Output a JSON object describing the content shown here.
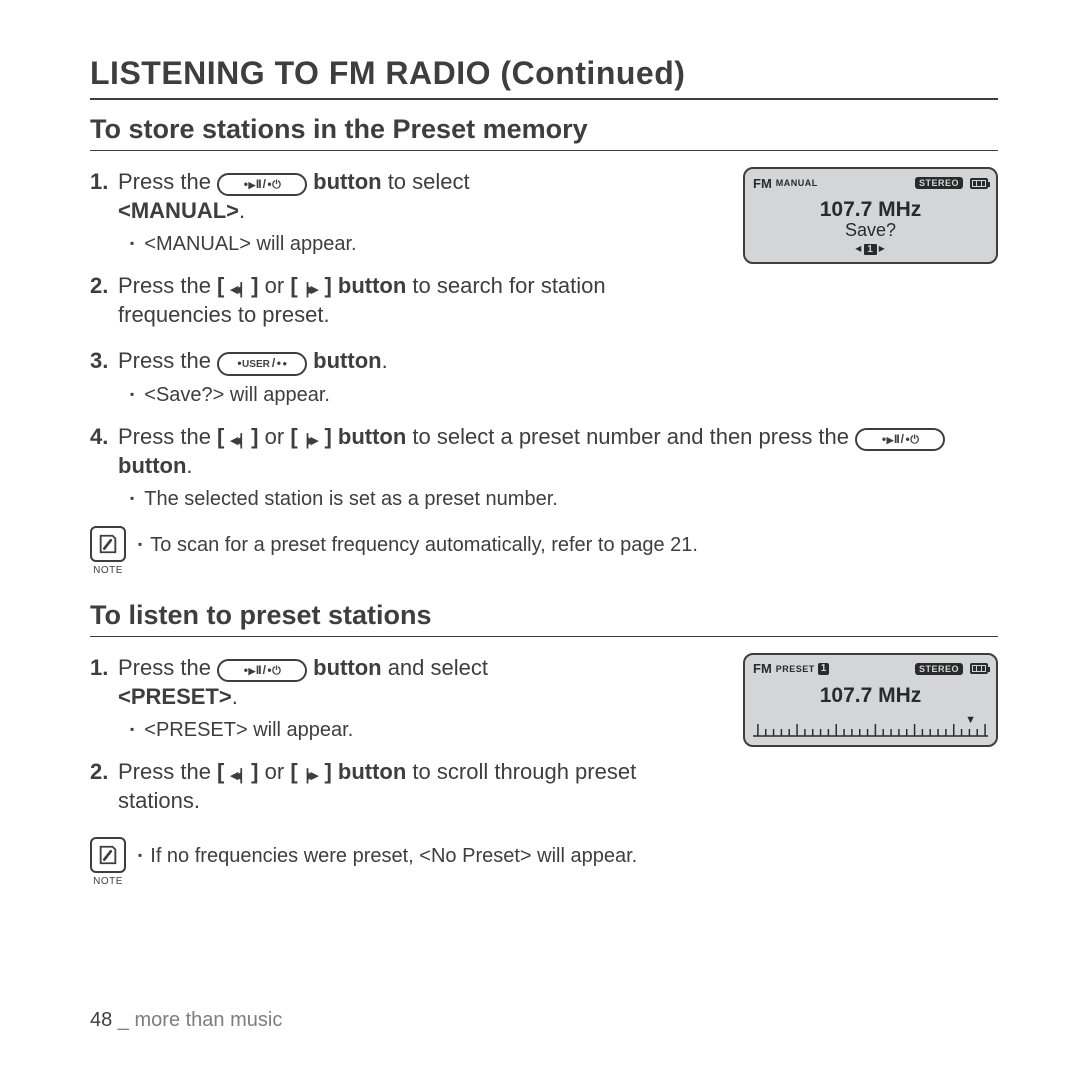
{
  "page_title": "LISTENING TO FM RADIO (Continued)",
  "section1": {
    "title": "To store stations in the Preset memory",
    "step1": {
      "num": "1.",
      "t1": "Press the ",
      "btn_label_play": "play-pause-power",
      "t2": " button",
      "t3": " to select ",
      "t4": "<MANUAL>",
      "t5": "."
    },
    "sub1": "<MANUAL> will appear.",
    "step2": {
      "num": "2.",
      "t1": "Press the ",
      "skip_back": "⏮",
      "t2": " or ",
      "skip_fwd": "⏭",
      "t3": " button",
      "t4": " to search for station frequencies to preset."
    },
    "step3": {
      "num": "3.",
      "t1": "Press the ",
      "btn_label_user": "USER",
      "t2": " button",
      "t3": "."
    },
    "sub3": "<Save?> will appear.",
    "step4": {
      "num": "4.",
      "t1": "Press the ",
      "t2": " or ",
      "t3": " button",
      "t4": " to select a preset number and then press the ",
      "t5": " button",
      "t6": "."
    },
    "sub4": "The selected station is set as a preset number.",
    "note": {
      "label": "NOTE",
      "text": "To scan for a preset frequency automatically, refer to page 21."
    }
  },
  "section2": {
    "title": "To listen to preset stations",
    "step1": {
      "num": "1.",
      "t1": "Press the ",
      "t2": " button",
      "t3": " and select ",
      "t4": "<PRESET>",
      "t5": "."
    },
    "sub1": "<PRESET> will appear.",
    "step2": {
      "num": "2.",
      "t1": "Press the ",
      "t2": " or ",
      "t3": " button",
      "t4": " to scroll through preset stations."
    },
    "note": {
      "label": "NOTE",
      "text": "If no frequencies were preset, <No Preset> will appear."
    }
  },
  "device1": {
    "fm": "FM",
    "mode": "MANUAL",
    "stereo": "STEREO",
    "freq": "107.7 MHz",
    "save": "Save?",
    "sel": "1"
  },
  "device2": {
    "fm": "FM",
    "mode": "PRESET",
    "preset_num": "1",
    "stereo": "STEREO",
    "freq": "107.7 MHz"
  },
  "footer": {
    "page": "48",
    "sep": " _ ",
    "label": "more than music"
  }
}
